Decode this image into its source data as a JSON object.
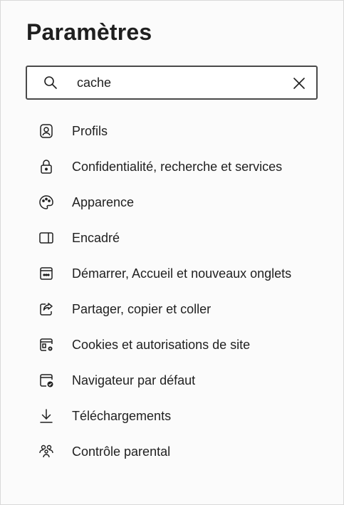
{
  "page": {
    "title": "Paramètres"
  },
  "search": {
    "value": "cache",
    "icon": "search-icon",
    "clear_icon": "close-icon"
  },
  "sidebar": {
    "items": [
      {
        "label": "Profils",
        "icon": "profile-icon"
      },
      {
        "label": "Confidentialité, recherche et services",
        "icon": "lock-icon"
      },
      {
        "label": "Apparence",
        "icon": "palette-icon"
      },
      {
        "label": "Encadré",
        "icon": "sidebar-panel-icon"
      },
      {
        "label": "Démarrer, Accueil et nouveaux onglets",
        "icon": "home-grid-icon"
      },
      {
        "label": "Partager, copier et coller",
        "icon": "share-icon"
      },
      {
        "label": "Cookies et autorisations de site",
        "icon": "cookie-settings-icon"
      },
      {
        "label": "Navigateur par défaut",
        "icon": "default-browser-icon"
      },
      {
        "label": "Téléchargements",
        "icon": "download-icon"
      },
      {
        "label": "Contrôle parental",
        "icon": "family-icon"
      }
    ]
  }
}
